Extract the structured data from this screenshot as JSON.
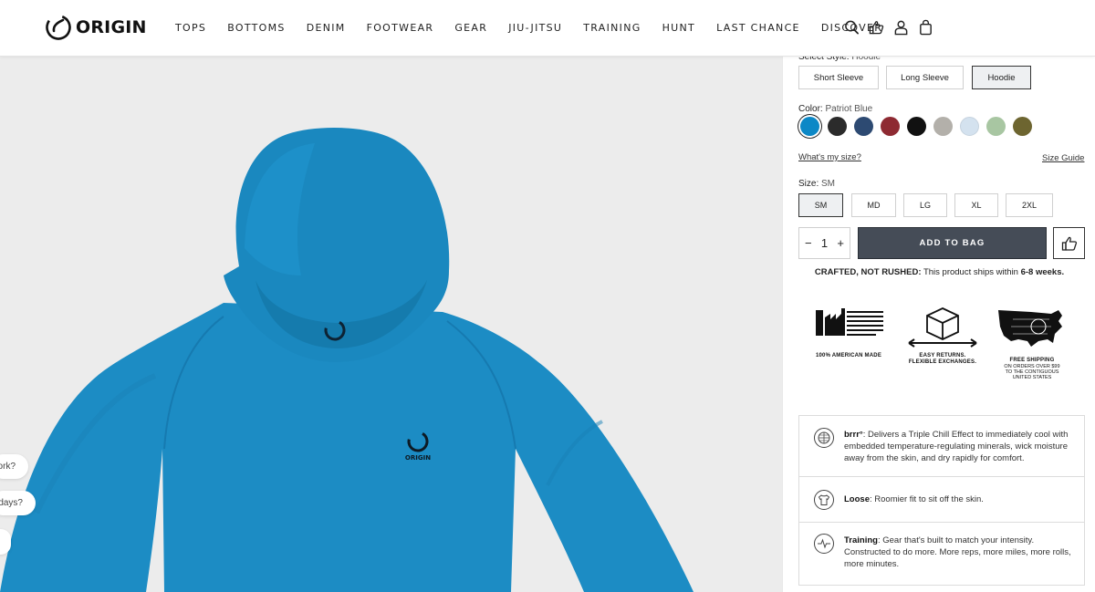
{
  "brand": {
    "name": "ORIGIN"
  },
  "nav": [
    "TOPS",
    "BOTTOMS",
    "DENIM",
    "FOOTWEAR",
    "GEAR",
    "JIU-JITSU",
    "TRAINING",
    "HUNT",
    "LAST CHANCE",
    "DISCOVER"
  ],
  "header_icons": [
    "search-icon",
    "thumbs-up-icon",
    "user-icon",
    "bag-icon"
  ],
  "chat_chips": [
    "ork?",
    "days?"
  ],
  "style": {
    "label": "Select Style:",
    "selected": "Hoodie",
    "options": [
      "Short Sleeve",
      "Long Sleeve",
      "Hoodie"
    ]
  },
  "color": {
    "label": "Color:",
    "selected": "Patriot Blue",
    "swatches": [
      "#0c88c6",
      "#2b2b2b",
      "#2d4a72",
      "#8e2a32",
      "#111111",
      "#b3b0aa",
      "#d4e2ef",
      "#a8c6a2",
      "#6d6530"
    ]
  },
  "size": {
    "whats_my_size": "What's my size?",
    "size_guide": "Size Guide",
    "label": "Size:",
    "selected": "SM",
    "options": [
      "SM",
      "MD",
      "LG",
      "XL",
      "2XL"
    ]
  },
  "purchase": {
    "qty_minus": "−",
    "qty_value": "1",
    "qty_plus": "+",
    "add_to_bag": "ADD TO BAG"
  },
  "ship_note": {
    "bold": "CRAFTED, NOT RUSHED:",
    "text": " This product ships within ",
    "weeks": "6-8 weeks."
  },
  "badges": {
    "american": "100% AMERICAN MADE",
    "returns_1": "EASY RETURNS.",
    "returns_2": "FLEXIBLE EXCHANGES.",
    "shipping": "FREE SHIPPING",
    "shipping_sub_1": "ON ORDERS OVER $99",
    "shipping_sub_2": "TO THE CONTIGUOUS",
    "shipping_sub_3": "UNITED STATES"
  },
  "features": [
    {
      "title": "brrr°",
      "text": ": Delivers a Triple Chill Effect to immediately cool with embedded temperature-regulating minerals, wick moisture away from the skin, and dry rapidly for comfort."
    },
    {
      "title": "Loose",
      "text": ": Roomier fit to sit off the skin."
    },
    {
      "title": "Training",
      "text": ": Gear that's built to match your intensity. Constructed to do more. More reps, more miles, more rolls, more minutes."
    }
  ],
  "product_logo_text": "ORIGIN"
}
